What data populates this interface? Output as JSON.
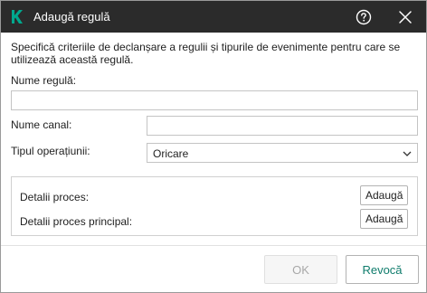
{
  "dialog": {
    "title": "Adaugă regulă",
    "description": "Specifică criteriile de declanșare a regulii și tipurile de evenimente pentru care se utilizează această regulă."
  },
  "icons": {
    "logo": "kaspersky-logo-icon",
    "help": "help-circle-icon",
    "close": "close-icon",
    "dropdown": "chevron-down-icon"
  },
  "form": {
    "rule_name_label": "Nume regulă:",
    "rule_name_value": "",
    "channel_name_label": "Nume canal:",
    "channel_name_value": "",
    "operation_type_label": "Tipul operațiunii:",
    "operation_type_value": "Oricare"
  },
  "process_details": {
    "process_label": "Detalii proces:",
    "process_add": "Adaugă",
    "parent_process_label": "Detalii proces principal:",
    "parent_process_add": "Adaugă"
  },
  "footer": {
    "ok_label": "OK",
    "cancel_label": "Revocă"
  },
  "colors": {
    "titlebar": "#2b2b2b",
    "brand_green": "#00a88e",
    "cancel_text": "#0f7c6c"
  }
}
